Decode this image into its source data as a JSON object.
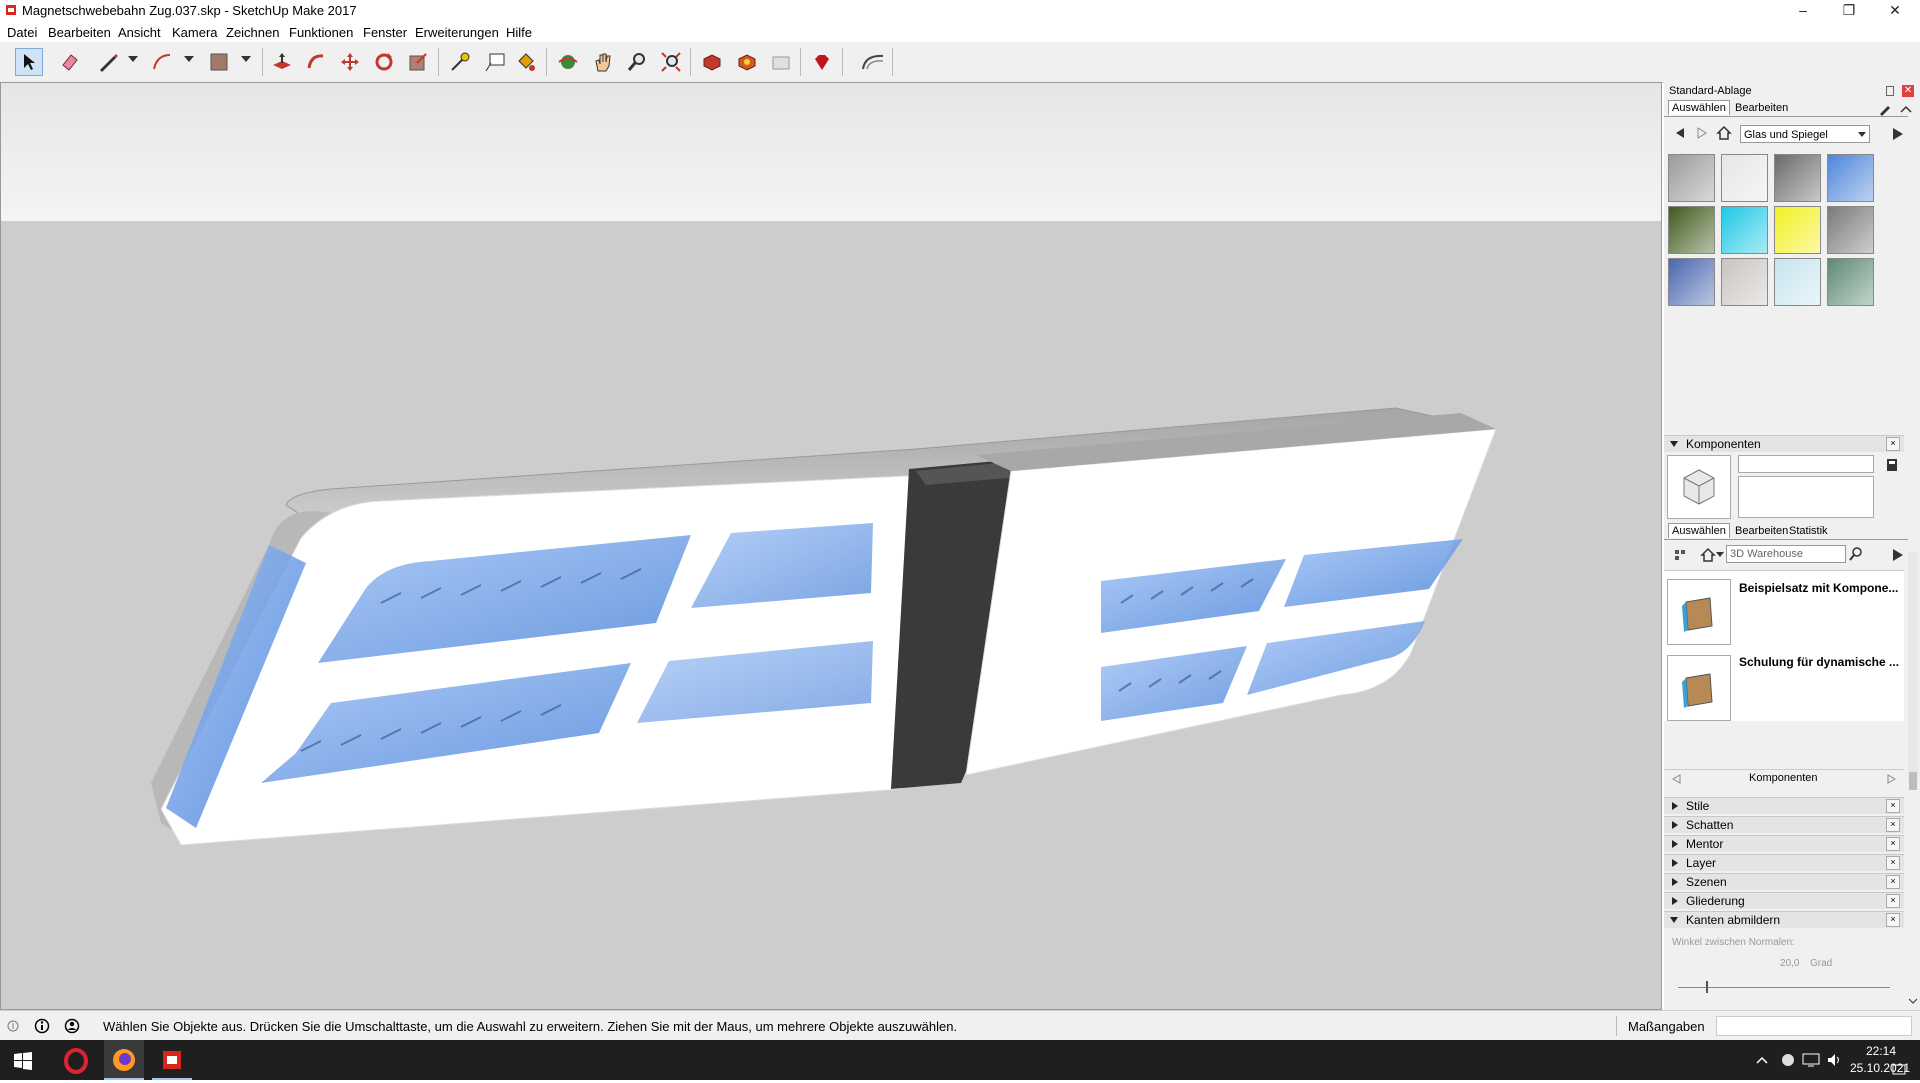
{
  "window": {
    "title": "Magnetschwebebahn Zug.037.skp - SketchUp Make 2017",
    "minimize": "–",
    "maximize": "❐",
    "close": "✕"
  },
  "menu": [
    "Datei",
    "Bearbeiten",
    "Ansicht",
    "Kamera",
    "Zeichnen",
    "Funktionen",
    "Fenster",
    "Erweiterungen",
    "Hilfe"
  ],
  "toolbar": {
    "tools": [
      "select-tool-icon",
      "eraser-tool-icon",
      "pencil-line-tool-icon",
      "arc-tool-icon",
      "rectangle-tool-icon",
      "push-pull-tool-icon",
      "follow-me-tool-icon",
      "move-tool-icon",
      "rotate-tool-icon",
      "scale-tool-icon",
      "tape-measure-tool-icon",
      "text-tool-icon",
      "paint-bucket-tool-icon",
      "orbit-tool-icon",
      "pan-tool-icon",
      "zoom-tool-icon",
      "zoom-extents-tool-icon",
      "3d-warehouse-icon",
      "extension-warehouse-icon",
      "share-model-icon",
      "ruby-console-icon",
      "sandbox-icon"
    ]
  },
  "tray": {
    "title": "Standard-Ablage",
    "materials": {
      "tab_select": "Auswählen",
      "tab_edit": "Bearbeiten",
      "collection": "Glas und Spiegel",
      "swatch_colors": [
        "#9a9a9a",
        "#e6e6e6",
        "#6a6a6a",
        "#4f86d9",
        "#3f5a1c",
        "#1ec8e6",
        "#f2f020",
        "#7a7a7a",
        "#4a66b0",
        "#c8c4c0",
        "#c6e4ee",
        "#5d8a76"
      ]
    },
    "components": {
      "title": "Komponenten",
      "tab_select": "Auswählen",
      "tab_edit": "Bearbeiten",
      "tab_stats": "Statistik",
      "search_placeholder": "3D Warehouse",
      "items": [
        {
          "label": "Beispielsatz mit Kompone..."
        },
        {
          "label": "Schulung für dynamische ..."
        }
      ],
      "footer": "Komponenten"
    },
    "sections": [
      {
        "label": "Stile",
        "expanded": false
      },
      {
        "label": "Schatten",
        "expanded": false
      },
      {
        "label": "Mentor",
        "expanded": false
      },
      {
        "label": "Layer",
        "expanded": false
      },
      {
        "label": "Szenen",
        "expanded": false
      },
      {
        "label": "Gliederung",
        "expanded": false
      },
      {
        "label": "Kanten abmildern",
        "expanded": true
      }
    ],
    "soften": {
      "angle_label": "Winkel zwischen Normalen:",
      "angle_value": "20,0",
      "angle_unit": "Grad"
    }
  },
  "status": {
    "message": "Wählen Sie Objekte aus. Drücken Sie die Umschalttaste, um die Auswahl zu erweitern. Ziehen Sie mit der Maus, um mehrere Objekte auszuwählen.",
    "measurements_label": "Maßangaben",
    "measurements_value": ""
  },
  "taskbar": {
    "time": "22:14",
    "date": "25.10.2021"
  }
}
